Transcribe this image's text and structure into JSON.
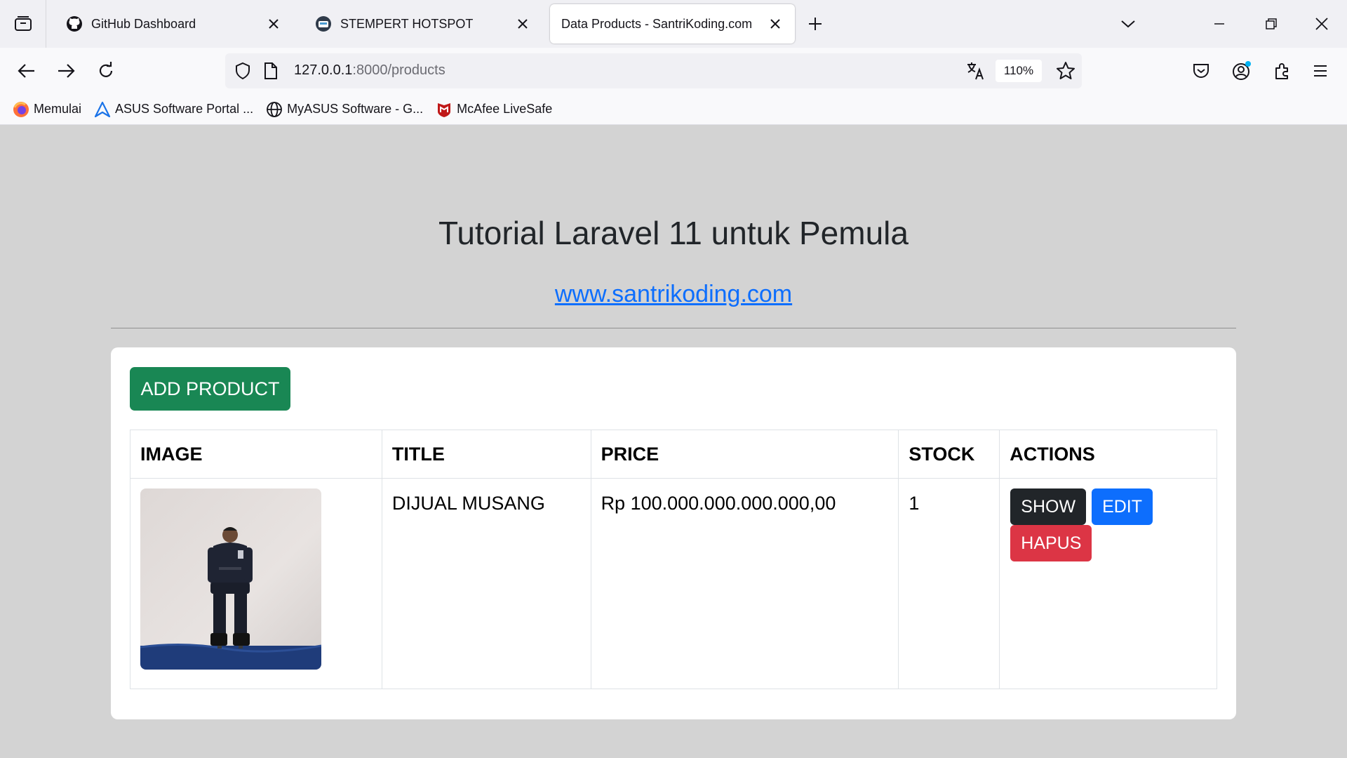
{
  "browser": {
    "tabs": [
      {
        "title": "GitHub Dashboard",
        "icon": "github-icon",
        "active": false
      },
      {
        "title": "STEMPERT HOTSPOT",
        "icon": "hotspot-icon",
        "active": false
      },
      {
        "title": "Data Products - SantriKoding.com",
        "icon": "none",
        "active": true
      }
    ],
    "url": {
      "host": "127.0.0.1",
      "path": ":8000/products"
    },
    "zoom": "110%",
    "bookmarks": [
      {
        "label": "Memulai",
        "icon": "firefox-icon"
      },
      {
        "label": "ASUS Software Portal ...",
        "icon": "asus-icon"
      },
      {
        "label": "MyASUS Software - G...",
        "icon": "globe-icon"
      },
      {
        "label": "McAfee LiveSafe",
        "icon": "mcafee-icon"
      }
    ]
  },
  "page": {
    "title": "Tutorial Laravel 11 untuk Pemula",
    "link": "www.santrikoding.com",
    "add_button": "ADD PRODUCT",
    "table": {
      "headers": [
        "IMAGE",
        "TITLE",
        "PRICE",
        "STOCK",
        "ACTIONS"
      ],
      "rows": [
        {
          "title": "DIJUAL MUSANG",
          "price": "Rp 100.000.000.000.000,00",
          "stock": "1"
        }
      ]
    },
    "actions": {
      "show": "SHOW",
      "edit": "EDIT",
      "delete": "HAPUS"
    }
  },
  "colors": {
    "page_bg": "#d3d3d3",
    "add_button": "#198754",
    "show_button": "#212529",
    "edit_button": "#0d6efd",
    "delete_button": "#dc3545",
    "link": "#0d6efd"
  }
}
